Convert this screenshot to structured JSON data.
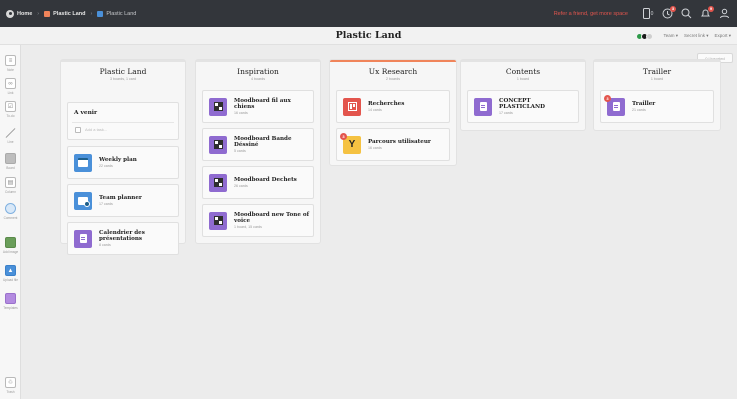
{
  "topbar": {
    "breadcrumbs": [
      {
        "label": "Home"
      },
      {
        "label": "Plastic Land",
        "color": "#f0845a"
      },
      {
        "label": "Plastic Land",
        "color": "#4a90d9"
      }
    ],
    "refer_text": "Refer a friend, get more space",
    "device_count": "0",
    "notification_badges": [
      "3",
      "9"
    ]
  },
  "board": {
    "title": "Plastic Land",
    "share_links": [
      "Team ▾",
      "Secret link ▾",
      "Export ▾"
    ]
  },
  "toolbar": {
    "tools": [
      {
        "label": "Note",
        "icon": "note-icon"
      },
      {
        "label": "Link",
        "icon": "link-icon"
      },
      {
        "label": "To-do",
        "icon": "todo-icon"
      },
      {
        "label": "Line",
        "icon": "line-icon"
      },
      {
        "label": "Board",
        "icon": "board-icon"
      },
      {
        "label": "Column",
        "icon": "column-icon"
      },
      {
        "label": "Comment",
        "icon": "comment-icon"
      },
      {
        "label": "Add image",
        "icon": "image-icon"
      },
      {
        "label": "Upload file",
        "icon": "upload-icon"
      },
      {
        "label": "Templates",
        "icon": "template-icon"
      },
      {
        "label": "Trash",
        "icon": "trash-icon"
      }
    ]
  },
  "unsorted_label": "0 Unsorted",
  "columns": [
    {
      "title": "Plastic Land",
      "subtitle": "3 boards, 1 card",
      "todo": {
        "title": "A venir",
        "placeholder": "Add a task..."
      },
      "cards": [
        {
          "title": "Weekly plan",
          "subtitle": "22 cards",
          "color": "#4a90d9",
          "icon": "calendar-icon"
        },
        {
          "title": "Team planner",
          "subtitle": "17 cards",
          "color": "#4a90d9",
          "icon": "team-icon"
        },
        {
          "title": "Calendrier des présentations",
          "subtitle": "8 cards",
          "color": "#8f6bd0",
          "icon": "document-icon"
        }
      ]
    },
    {
      "title": "Inspiration",
      "subtitle": "4 boards",
      "cards": [
        {
          "title": "Moodboard fil aux chiens",
          "subtitle": "16 cards",
          "color": "#8f6bd0",
          "icon": "moodboard-icon"
        },
        {
          "title": "Moodboard Bande Déssiné",
          "subtitle": "5 cards",
          "color": "#8f6bd0",
          "icon": "moodboard-icon"
        },
        {
          "title": "Moodboard Dechets",
          "subtitle": "26 cards",
          "color": "#8f6bd0",
          "icon": "moodboard-icon"
        },
        {
          "title": "Moodboard new Tone of voice",
          "subtitle": "1 board, 15 cards",
          "color": "#8f6bd0",
          "icon": "moodboard-icon"
        }
      ]
    },
    {
      "title": "Ux Research",
      "subtitle": "2 boards",
      "cards": [
        {
          "title": "Recherches",
          "subtitle": "14 cards",
          "color": "#e3554d",
          "icon": "kanban-icon"
        },
        {
          "title": "Parcours utilisateur",
          "subtitle": "16 cards",
          "color": "#f5c242",
          "icon": "branch-icon",
          "badge": "3"
        }
      ]
    },
    {
      "title": "Contents",
      "subtitle": "1 board",
      "cards": [
        {
          "title": "CONCEPT PLASTICLAND",
          "subtitle": "17 cards",
          "color": "#8f6bd0",
          "icon": "document-icon"
        }
      ]
    },
    {
      "title": "Trailler",
      "subtitle": "1 board",
      "cards": [
        {
          "title": "Trailler",
          "subtitle": "21 cards",
          "color": "#8f6bd0",
          "icon": "document-icon",
          "badge": "3"
        }
      ]
    }
  ]
}
